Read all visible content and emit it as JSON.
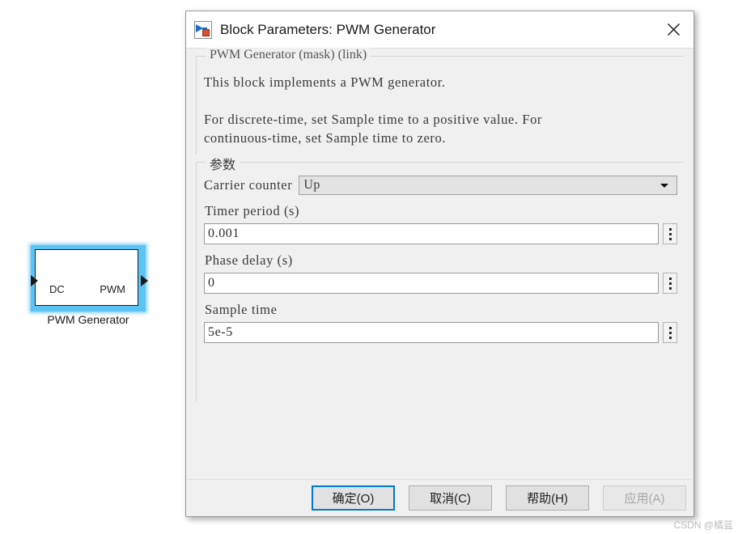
{
  "canvas": {
    "block": {
      "input_port_label": "DC",
      "output_port_label": "PWM",
      "caption": "PWM Generator"
    }
  },
  "dialog": {
    "title": "Block Parameters: PWM Generator",
    "title_icon": "simulink-block-icon",
    "close_icon": "close-icon",
    "description": {
      "legend": "PWM Generator (mask) (link)",
      "body": "This block implements a PWM generator.\n\nFor discrete-time, set Sample time to a positive value. For\ncontinuous-time, set Sample time to zero."
    },
    "parameters": {
      "legend": "参数",
      "carrier_counter": {
        "label": "Carrier counter",
        "value": "Up",
        "caret_icon": "chevron-down-icon"
      },
      "timer_period": {
        "label": "Timer period (s)",
        "value": "0.001",
        "side_button_icon": "vertical-ellipsis-icon"
      },
      "phase_delay": {
        "label": "Phase delay (s)",
        "value": "0",
        "side_button_icon": "vertical-ellipsis-icon"
      },
      "sample_time": {
        "label": "Sample time",
        "value": "5e-5",
        "side_button_icon": "vertical-ellipsis-icon"
      }
    },
    "buttons": {
      "ok": "确定(O)",
      "cancel": "取消(C)",
      "help": "帮助(H)",
      "apply": "应用(A)"
    },
    "accent_color": "#0078d7"
  },
  "watermark": "CSDN @橘蓝"
}
